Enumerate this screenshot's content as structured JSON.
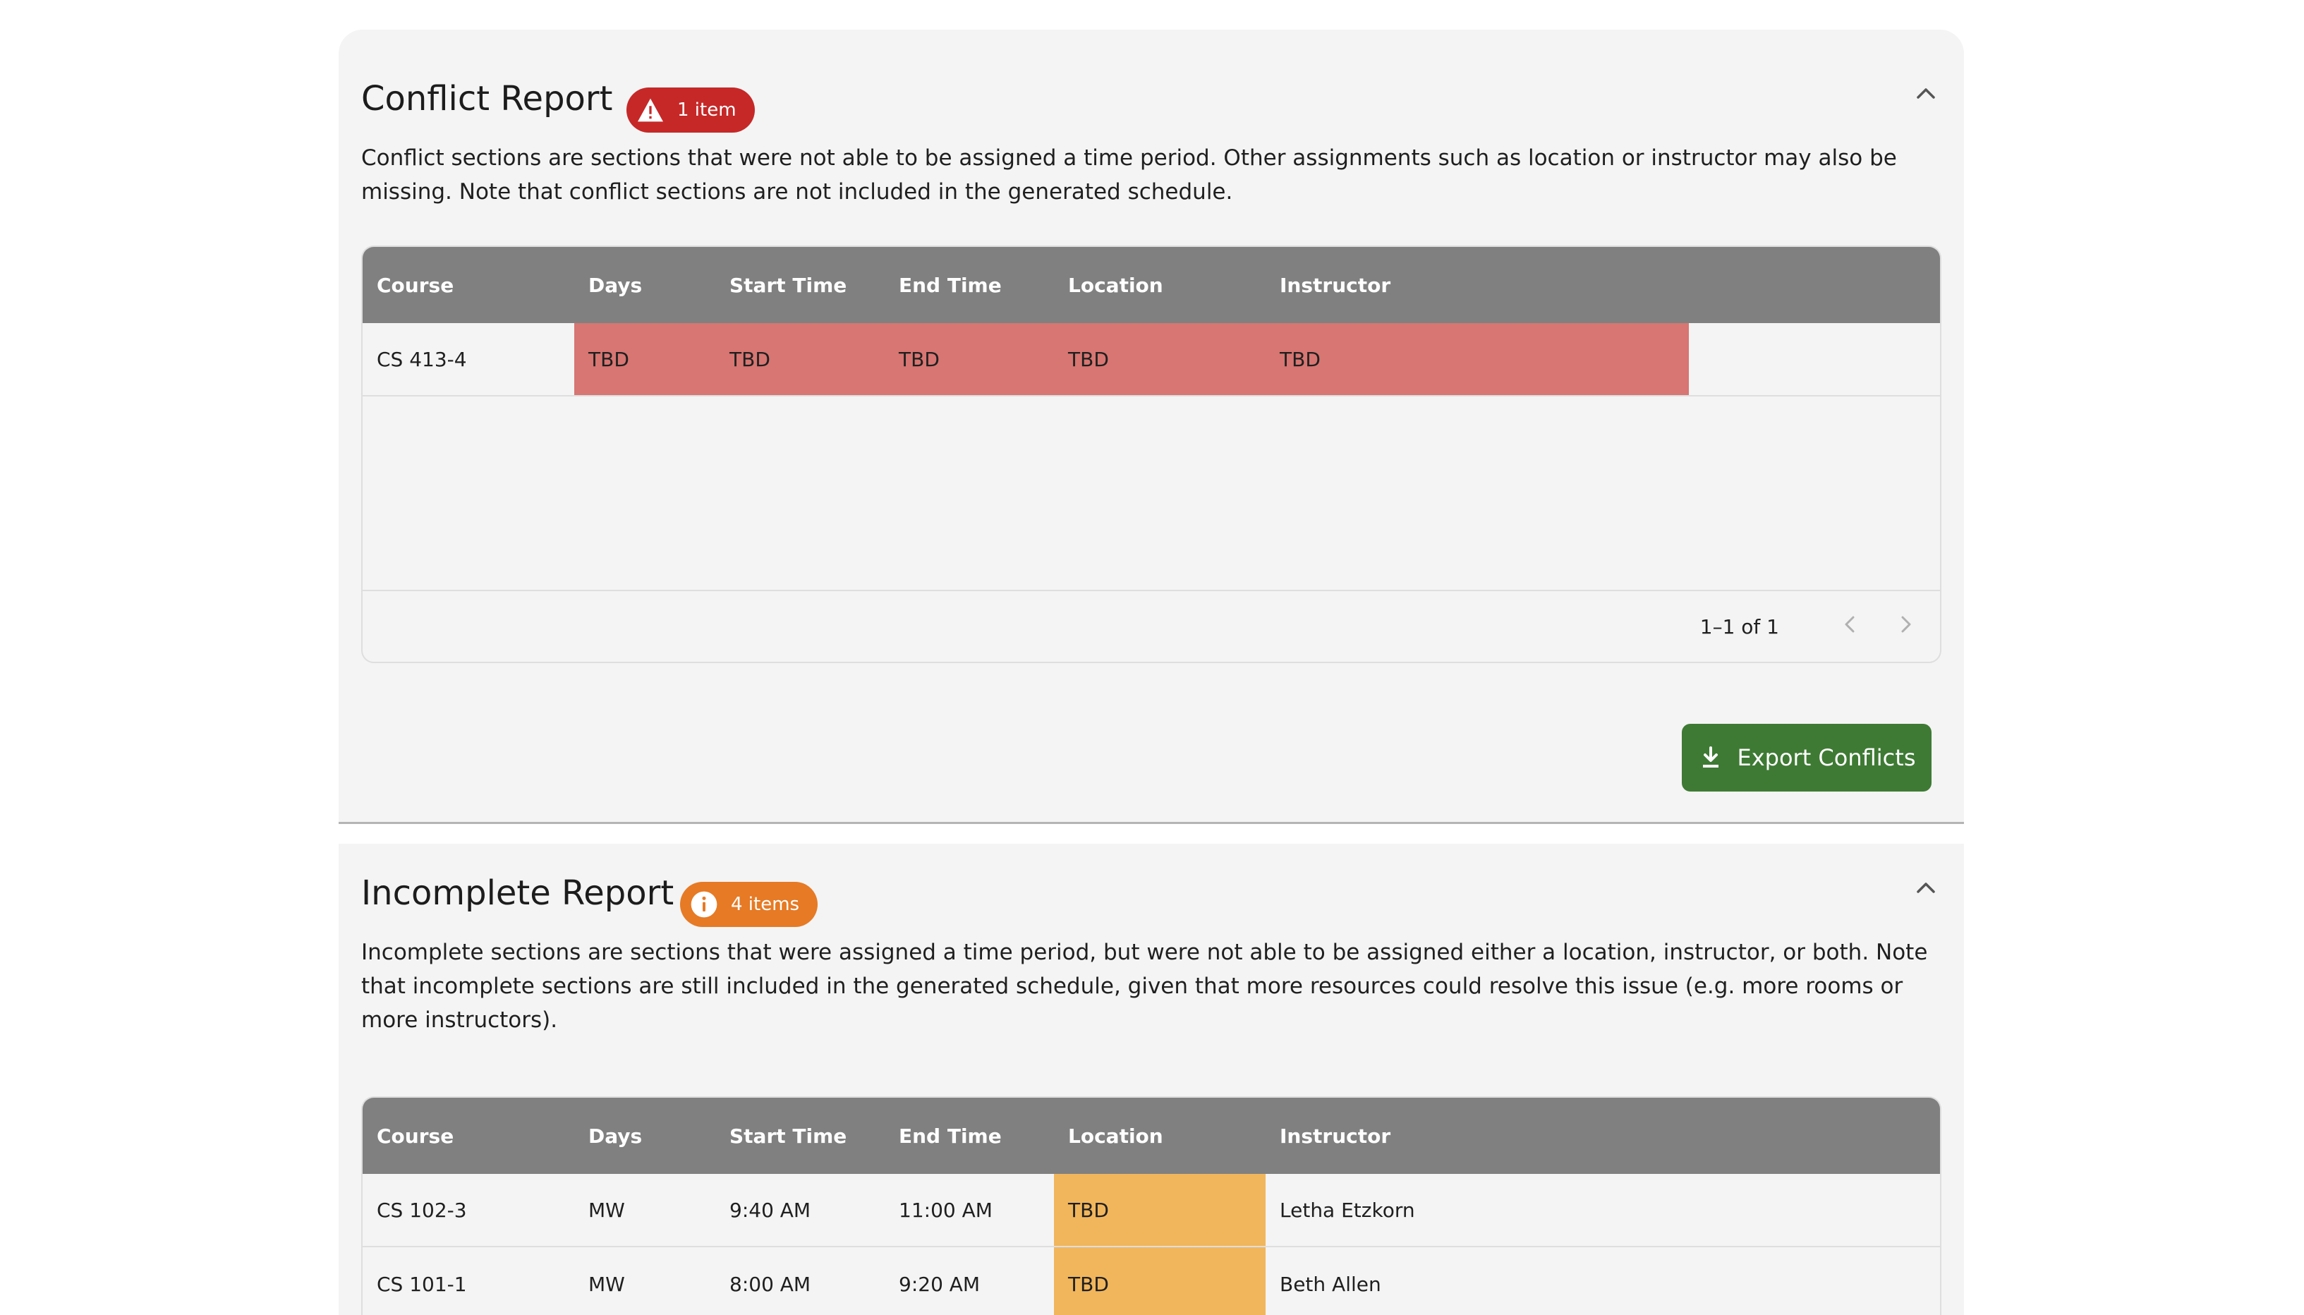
{
  "conflict_report": {
    "title": "Conflict Report",
    "badge": "1 item",
    "badge_icon": "warning-icon",
    "badge_color": "#c62828",
    "description": "Conflict sections are sections that were not able to be assigned a time period. Other assignments such as location or instructor may also be missing. Note that conflict sections are not included in the generated schedule.",
    "columns": [
      "Course",
      "Days",
      "Start Time",
      "End Time",
      "Location",
      "Instructor"
    ],
    "rows": [
      {
        "course": "CS 413-4",
        "days": "TBD",
        "start": "TBD",
        "end": "TBD",
        "location": "TBD",
        "instructor": "TBD"
      }
    ],
    "highlight_color": "#d77672",
    "pagination": "1–1 of 1",
    "export_label": "Export Conflicts",
    "export_color": "#3e7a34"
  },
  "incomplete_report": {
    "title": "Incomplete Report",
    "badge": "4 items",
    "badge_icon": "info-icon",
    "badge_color": "#e67a25",
    "description": "Incomplete sections are sections that were assigned a time period, but were not able to be assigned either a location, instructor, or both. Note that incomplete sections are still included in the generated schedule, given that more resources could resolve this issue (e.g. more rooms or more instructors).",
    "columns": [
      "Course",
      "Days",
      "Start Time",
      "End Time",
      "Location",
      "Instructor"
    ],
    "rows": [
      {
        "course": "CS 102-3",
        "days": "MW",
        "start": "9:40 AM",
        "end": "11:00 AM",
        "location": "TBD",
        "instructor": "Letha Etzkorn"
      },
      {
        "course": "CS 101-1",
        "days": "MW",
        "start": "8:00 AM",
        "end": "9:20 AM",
        "location": "TBD",
        "instructor": "Beth Allen"
      }
    ],
    "highlight_color": "#f1b65c"
  },
  "colors": {
    "header_bg": "#808080",
    "panel_bg": "#f4f4f4"
  }
}
